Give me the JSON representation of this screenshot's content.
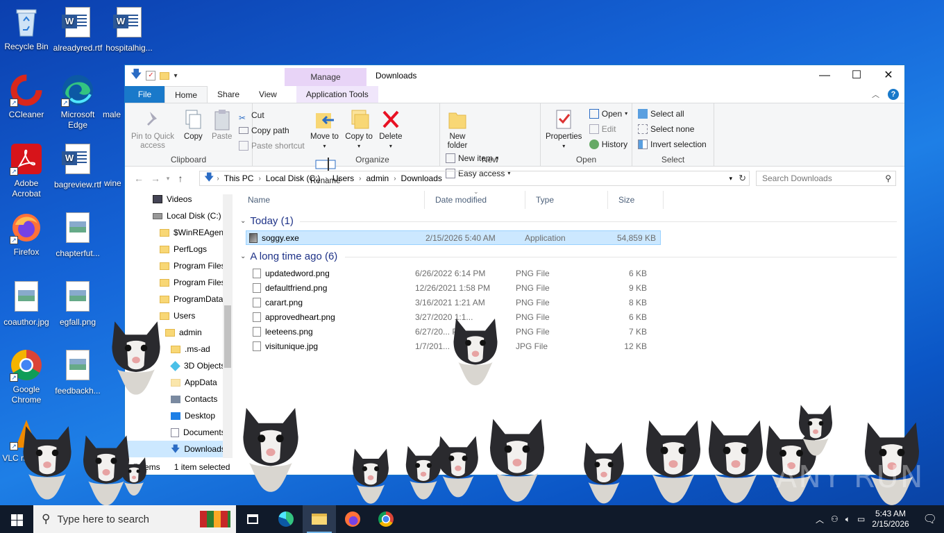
{
  "desktop": {
    "icons": [
      {
        "label": "Recycle Bin"
      },
      {
        "label": "alreadyred.rtf"
      },
      {
        "label": "hospitalhig..."
      },
      {
        "label": "CCleaner"
      },
      {
        "label": "Microsoft Edge"
      },
      {
        "label": "male"
      },
      {
        "label": "Adobe Acrobat"
      },
      {
        "label": "bagreview.rtf"
      },
      {
        "label": "wine"
      },
      {
        "label": "Firefox"
      },
      {
        "label": "chapterfut..."
      },
      {
        "label": "coauthor.jpg"
      },
      {
        "label": "egfall.png"
      },
      {
        "label": "Google Chrome"
      },
      {
        "label": "feedbackh..."
      },
      {
        "label": "VLC m... pl..."
      }
    ]
  },
  "window": {
    "manage_tab": "Manage",
    "title": "Downloads",
    "tabs": {
      "file": "File",
      "home": "Home",
      "share": "Share",
      "view": "View",
      "app_tools": "Application Tools"
    },
    "ribbon": {
      "clipboard": {
        "label": "Clipboard",
        "pin": "Pin to Quick access",
        "copy": "Copy",
        "paste": "Paste",
        "cut": "Cut",
        "copy_path": "Copy path",
        "paste_shortcut": "Paste shortcut"
      },
      "organize": {
        "label": "Organize",
        "move_to": "Move to",
        "copy_to": "Copy to",
        "delete": "Delete",
        "rename": "Rename"
      },
      "new": {
        "label": "New",
        "new_folder": "New folder",
        "new_item": "New item",
        "easy_access": "Easy access"
      },
      "open": {
        "label": "Open",
        "properties": "Properties",
        "open": "Open",
        "edit": "Edit",
        "history": "History"
      },
      "select": {
        "label": "Select",
        "select_all": "Select all",
        "select_none": "Select none",
        "invert": "Invert selection"
      }
    },
    "address": {
      "crumbs": [
        "This PC",
        "Local Disk (C:)",
        "Users",
        "admin",
        "Downloads"
      ]
    },
    "search": {
      "placeholder": "Search Downloads"
    },
    "nav": [
      {
        "label": "Videos"
      },
      {
        "label": "Local Disk (C:)"
      },
      {
        "label": "$WinREAgent"
      },
      {
        "label": "PerfLogs"
      },
      {
        "label": "Program Files"
      },
      {
        "label": "Program Files"
      },
      {
        "label": "ProgramData"
      },
      {
        "label": "Users"
      },
      {
        "label": "admin"
      },
      {
        "label": ".ms-ad"
      },
      {
        "label": "3D Objects"
      },
      {
        "label": "AppData"
      },
      {
        "label": "Contacts"
      },
      {
        "label": "Desktop"
      },
      {
        "label": "Documents"
      },
      {
        "label": "Downloads"
      }
    ],
    "columns": {
      "name": "Name",
      "date": "Date modified",
      "type": "Type",
      "size": "Size"
    },
    "groups": {
      "today": "Today (1)",
      "long_ago": "A long time ago (6)"
    },
    "files_today": [
      {
        "name": "soggy.exe",
        "date": "2/15/2026 5:40 AM",
        "type": "Application",
        "size": "54,859 KB"
      }
    ],
    "files_old": [
      {
        "name": "updatedword.png",
        "date": "6/26/2022 6:14 PM",
        "type": "PNG File",
        "size": "6 KB"
      },
      {
        "name": "defaultfriend.png",
        "date": "12/26/2021 1:58 PM",
        "type": "PNG File",
        "size": "9 KB"
      },
      {
        "name": "carart.png",
        "date": "3/16/2021 1:21 AM",
        "type": "PNG File",
        "size": "8 KB"
      },
      {
        "name": "approvedheart.png",
        "date": "3/27/2020 1:1...",
        "type": "PNG File",
        "size": "6 KB"
      },
      {
        "name": "leeteens.png",
        "date": "6/27/20... PM",
        "type": "PNG File",
        "size": "7 KB"
      },
      {
        "name": "visitunique.jpg",
        "date": "1/7/201...",
        "type": "JPG File",
        "size": "12 KB"
      }
    ],
    "status": {
      "count": "7 items",
      "selected": "1 item selected"
    }
  },
  "taskbar": {
    "search_placeholder": "Type here to search",
    "time": "5:43 AM",
    "date": "2/15/2026"
  },
  "watermark": "ANY RUN",
  "colors": {
    "accent": "#1979ca",
    "manage": "#e8d4f7",
    "selection": "#cce8ff",
    "taskbar": "#101a2a"
  }
}
